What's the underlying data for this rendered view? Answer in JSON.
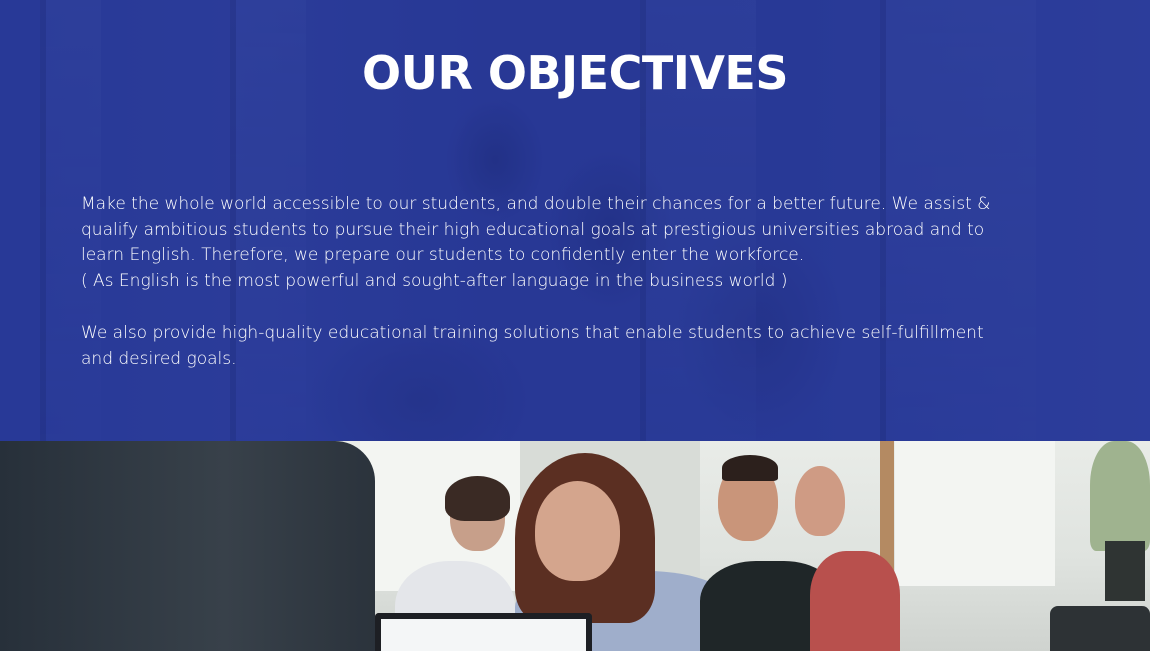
{
  "section": {
    "title": "OUR OBJECTIVES",
    "paragraphs": [
      {
        "lines": [
          "Make the whole world accessible to our students, and double their chances for a better future. We assist &",
          "qualify ambitious students to pursue their high educational goals at prestigious universities abroad and to",
          "learn English. Therefore, we prepare our students to confidently enter the workforce.",
          "( As English is the most powerful and sought-after language in the business world )"
        ]
      },
      {
        "lines": [
          "We also provide high-quality educational training solutions that enable students to achieve self-fulfillment",
          "and desired goals."
        ]
      }
    ]
  },
  "images": {
    "hero_background": "classroom-students-photo-blue-overlay",
    "bottom_photo": "classroom-lecture-photo"
  },
  "colors": {
    "overlay_blue": "#2a3a96",
    "text": "#ffffff"
  }
}
